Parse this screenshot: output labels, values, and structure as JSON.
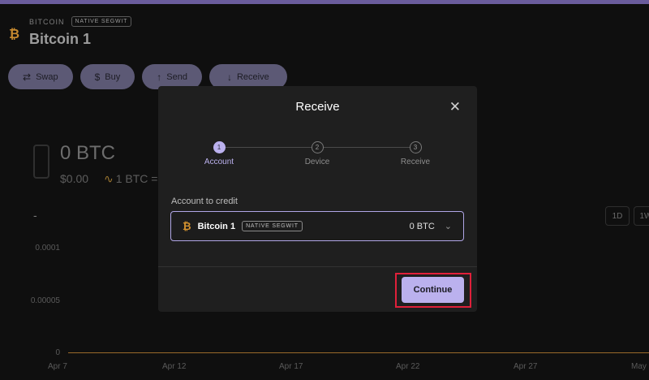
{
  "account": {
    "ticker": "BITCOIN",
    "badge": "NATIVE SEGWIT",
    "name": "Bitcoin 1"
  },
  "actions": [
    {
      "icon": "swap-icon",
      "label": "Swap"
    },
    {
      "icon": "dollar-icon",
      "label": "Buy"
    },
    {
      "icon": "upload-icon",
      "label": "Send"
    },
    {
      "icon": "download-icon",
      "label": "Receive"
    }
  ],
  "summary": {
    "balance": "0 BTC",
    "fiat": "$0.00",
    "rate": "1 BTC ="
  },
  "chart": {
    "dash": "-",
    "ranges": [
      "1D",
      "1W"
    ],
    "yticks": [
      "0.0001",
      "0.00005",
      "0"
    ],
    "xticks": [
      "Apr 7",
      "Apr 12",
      "Apr 17",
      "Apr 22",
      "Apr 27",
      "May"
    ]
  },
  "modal": {
    "title": "Receive",
    "steps": [
      {
        "num": "1",
        "label": "Account",
        "active": true
      },
      {
        "num": "2",
        "label": "Device",
        "active": false
      },
      {
        "num": "3",
        "label": "Receive",
        "active": false
      }
    ],
    "field_label": "Account to credit",
    "selected": {
      "name": "Bitcoin 1",
      "badge": "NATIVE SEGWIT",
      "amount": "0 BTC"
    },
    "continue_label": "Continue"
  },
  "colors": {
    "accent": "#bbb1ee",
    "btc": "#d2912f",
    "highlight": "#e0203a"
  }
}
